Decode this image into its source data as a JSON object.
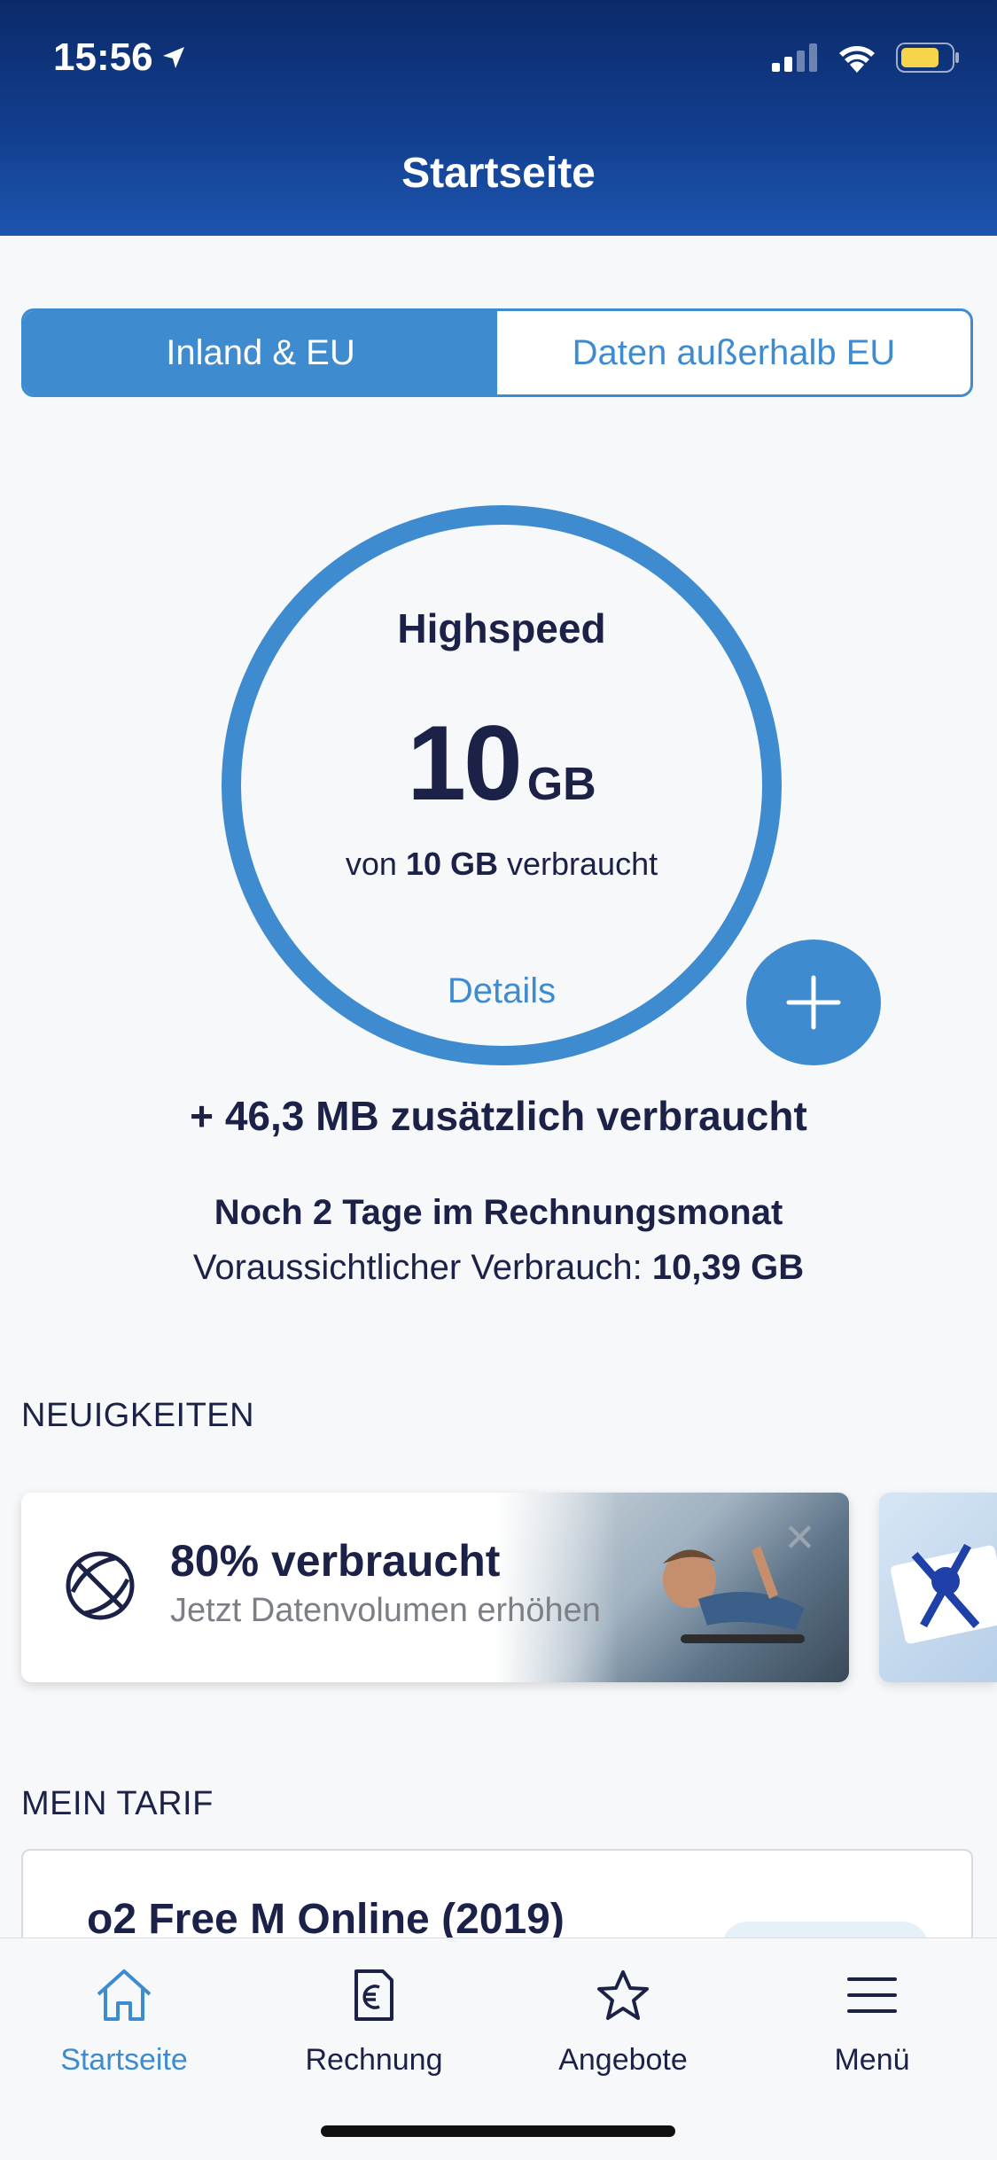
{
  "status_bar": {
    "time": "15:56"
  },
  "header": {
    "title": "Startseite"
  },
  "segments": {
    "active": "Inland & EU",
    "inactive": "Daten außerhalb EU"
  },
  "usage": {
    "title": "Highspeed",
    "value": "10",
    "unit": "GB",
    "sub_prefix": "von",
    "sub_bold": "10 GB",
    "sub_suffix": "verbraucht",
    "details": "Details",
    "extra": "+ 46,3 MB zusätzlich verbraucht",
    "remaining": "Noch 2 Tage im Rechnungsmonat",
    "forecast_label": "Voraussichtlicher Verbrauch:",
    "forecast_value": "10,39 GB"
  },
  "news": {
    "section_title": "NEUIGKEITEN",
    "card_title": "80% verbraucht",
    "card_subtitle": "Jetzt Datenvolumen erhöhen"
  },
  "tariff": {
    "section_title": "MEIN TARIF",
    "name": "o2 Free M Online (2019)"
  },
  "tabs": [
    {
      "label": "Startseite",
      "icon": "home-icon"
    },
    {
      "label": "Rechnung",
      "icon": "euro-document-icon"
    },
    {
      "label": "Angebote",
      "icon": "star-icon"
    },
    {
      "label": "Menü",
      "icon": "hamburger-menu-icon"
    }
  ],
  "colors": {
    "accent": "#3f8bd0",
    "header_dark": "#0b2a6a",
    "header_light": "#1c55ae",
    "text": "#1c2147"
  }
}
